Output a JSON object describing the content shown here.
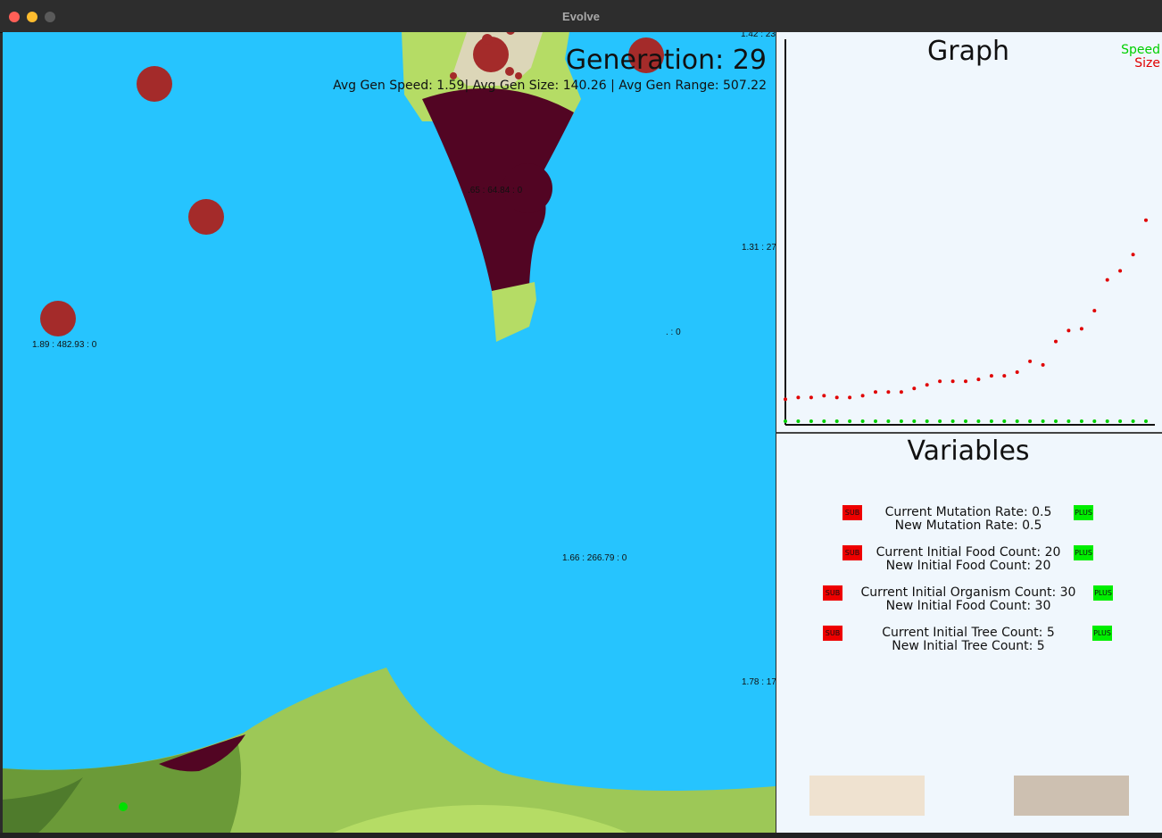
{
  "window": {
    "title": "Evolve"
  },
  "simulation": {
    "generation_label": "Generation: 29",
    "stats_line": "Avg Gen Speed: 1.59| Avg Gen Size: 140.26 | Avg Gen Range: 507.22",
    "organism_labels": [
      "1.42 : 23",
      ".65 : 64.84 : 0",
      "1.31 : 27",
      ". : 0",
      "1.89 : 482.93 : 0",
      "1.66 : 266.79 : 0",
      "1.78 : 17"
    ]
  },
  "graph": {
    "title": "Graph",
    "legend": {
      "speed": "Speed",
      "size": "Size"
    },
    "colors": {
      "speed": "#00d000",
      "size": "#e00000"
    }
  },
  "chart_data": {
    "type": "scatter",
    "title": "Graph",
    "xlabel": "",
    "ylabel": "",
    "x": [
      1,
      2,
      3,
      4,
      5,
      6,
      7,
      8,
      9,
      10,
      11,
      12,
      13,
      14,
      15,
      16,
      17,
      18,
      19,
      20,
      21,
      22,
      23,
      24,
      25,
      26,
      27,
      28,
      29
    ],
    "series": [
      {
        "name": "Speed",
        "values": [
          1.55,
          1.56,
          1.57,
          1.56,
          1.58,
          1.57,
          1.58,
          1.59,
          1.58,
          1.57,
          1.59,
          1.58,
          1.6,
          1.59,
          1.58,
          1.59,
          1.6,
          1.58,
          1.59,
          1.6,
          1.59,
          1.58,
          1.59,
          1.6,
          1.59,
          1.58,
          1.59,
          1.6,
          1.59
        ]
      },
      {
        "name": "Size",
        "values": [
          21,
          22,
          22,
          23,
          22,
          22,
          23,
          25,
          25,
          25,
          27,
          29,
          31,
          31,
          31,
          32,
          34,
          34,
          36,
          42,
          40,
          53,
          59,
          60,
          70,
          87,
          92,
          101,
          120
        ]
      }
    ],
    "ylim": [
      0,
      130
    ]
  },
  "variables": {
    "title": "Variables",
    "sub_label": "SUB",
    "plus_label": "PLUS",
    "rows": [
      {
        "current": "Current Mutation Rate: 0.5",
        "new": "New Mutation Rate: 0.5"
      },
      {
        "current": "Current Initial Food Count: 20",
        "new": "New Initial Food Count: 20"
      },
      {
        "current": "Current Initial Organism Count: 30",
        "new": "New Initial Food Count: 30"
      },
      {
        "current": "Current Initial Tree Count: 5",
        "new": "New Initial Tree Count: 5"
      }
    ]
  }
}
